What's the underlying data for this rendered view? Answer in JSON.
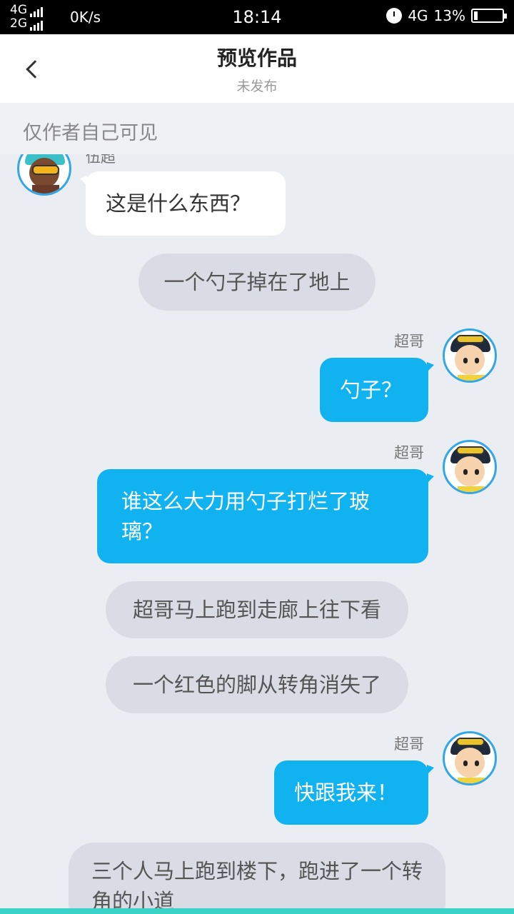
{
  "status": {
    "network_top": "4G",
    "network_bottom": "2G",
    "speed": "0K/s",
    "time": "18:14",
    "net_type": "4G",
    "battery": "13%",
    "battery_level": 0.13
  },
  "header": {
    "title": "预览作品",
    "subtitle": "未发布"
  },
  "notice": "仅作者自己可见",
  "messages": [
    {
      "type": "left",
      "name": "伍超",
      "text": "这是什么东西？"
    },
    {
      "type": "narration",
      "text": "一个勺子掉在了地上"
    },
    {
      "type": "right",
      "name": "超哥",
      "text": "勺子？"
    },
    {
      "type": "right",
      "name": "超哥",
      "text": "谁这么大力用勺子打烂了玻璃？"
    },
    {
      "type": "narration",
      "text": "超哥马上跑到走廊上往下看"
    },
    {
      "type": "narration",
      "text": "一个红色的脚从转角消失了"
    },
    {
      "type": "right",
      "name": "超哥",
      "text": "快跟我来！"
    },
    {
      "type": "narration",
      "text": "三个人马上跑到楼下，跑进了一个转角的小道"
    }
  ],
  "icons": {
    "back": "chevron-left-icon",
    "alarm": "alarm-icon",
    "battery": "battery-icon",
    "signal": "signal-bars-icon"
  },
  "colors": {
    "accent_bubble": "#10b2f0",
    "avatar_ring": "#34a6e6",
    "bottom_strip": "#39d3c8"
  }
}
